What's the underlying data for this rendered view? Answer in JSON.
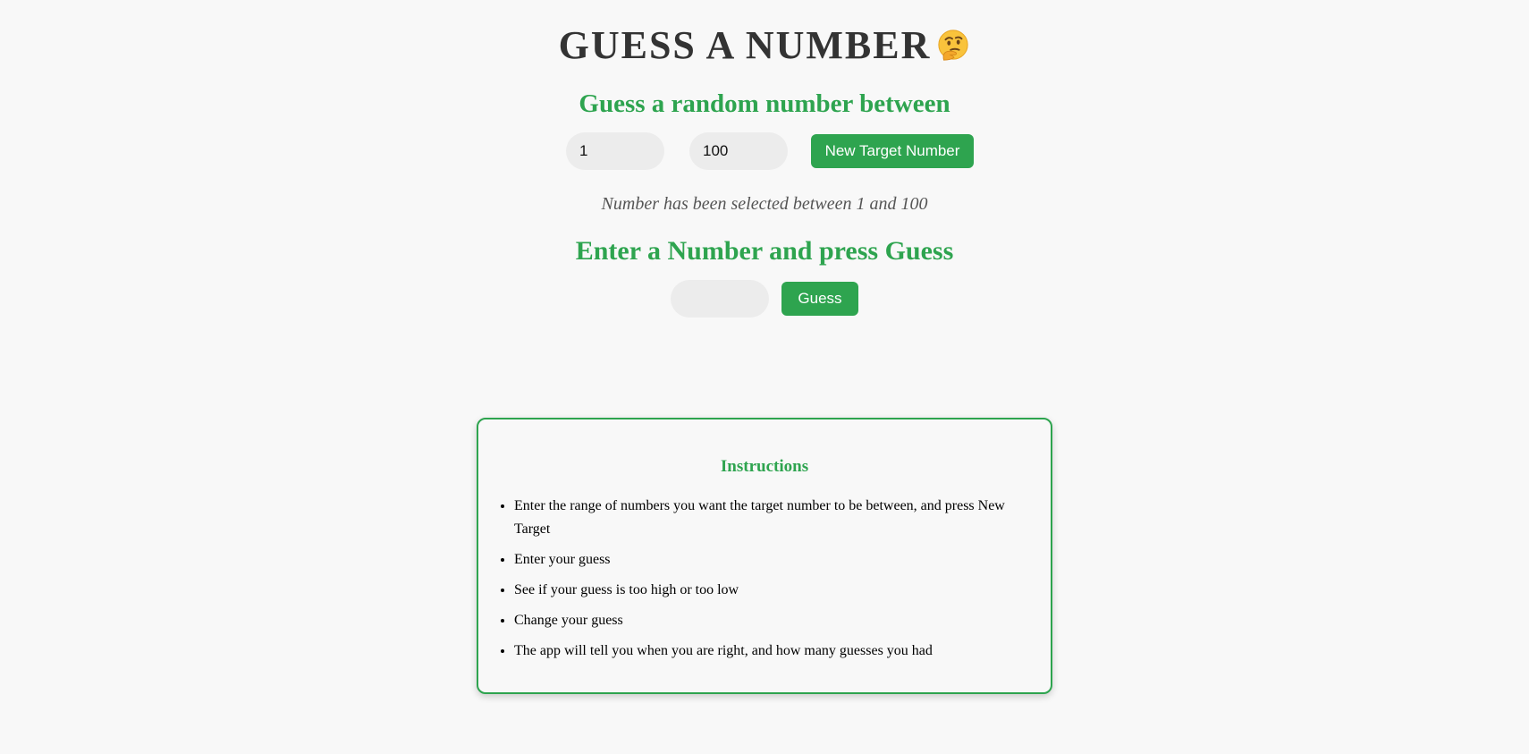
{
  "header": {
    "title": "GUESS A NUMBER",
    "title_emoji": "thinking-face-icon"
  },
  "range": {
    "heading": "Guess a random number between",
    "min_value": "1",
    "max_value": "100",
    "new_target_label": "New Target Number",
    "status": "Number has been selected between 1 and 100"
  },
  "guess": {
    "heading": "Enter a Number and press Guess",
    "input_value": "",
    "button_label": "Guess"
  },
  "instructions": {
    "heading": "Instructions",
    "items": [
      "Enter the range of numbers you want the target number to be between, and press New Target",
      "Enter your guess",
      "See if your guess is too high or too low",
      "Change your guess",
      "The app will tell you when you are right, and how many guesses you had"
    ]
  },
  "colors": {
    "accent": "#2ea44f",
    "background": "#f8f8f8",
    "input_bg": "#ececec",
    "title_text": "#333333"
  }
}
